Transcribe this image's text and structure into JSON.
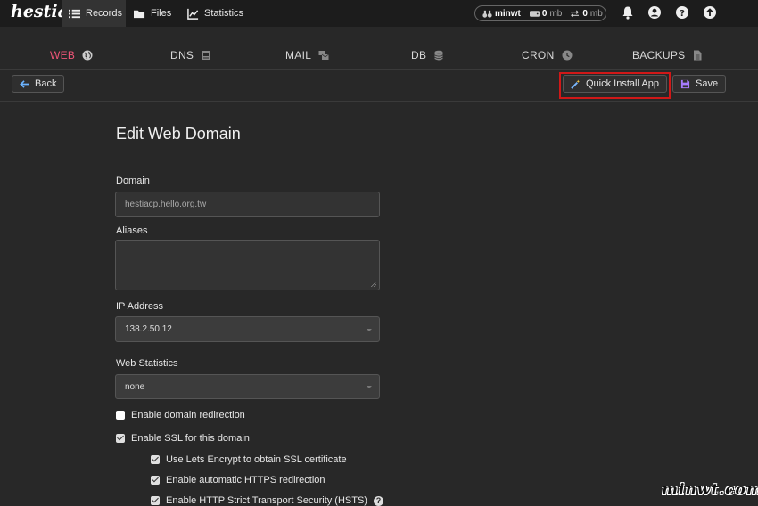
{
  "topbar": {
    "logo": "hestia",
    "nav": [
      {
        "label": "Records",
        "icon": "list-icon",
        "active": true
      },
      {
        "label": "Files",
        "icon": "folder-icon",
        "active": false
      },
      {
        "label": "Statistics",
        "icon": "chart-icon",
        "active": false
      }
    ],
    "stats": {
      "user": "minwt",
      "disk_value": "0",
      "disk_unit": "mb",
      "bandwidth_value": "0",
      "bandwidth_unit": "mb"
    }
  },
  "tabs": [
    {
      "label": "WEB",
      "icon": "globe-icon",
      "active": true
    },
    {
      "label": "DNS",
      "icon": "server-icon",
      "active": false
    },
    {
      "label": "MAIL",
      "icon": "mail-icon",
      "active": false
    },
    {
      "label": "DB",
      "icon": "database-icon",
      "active": false
    },
    {
      "label": "CRON",
      "icon": "clock-icon",
      "active": false
    },
    {
      "label": "BACKUPS",
      "icon": "file-icon",
      "active": false
    }
  ],
  "toolbar": {
    "back_label": "Back",
    "quick_install_label": "Quick Install App",
    "save_label": "Save"
  },
  "form": {
    "title": "Edit Web Domain",
    "domain_label": "Domain",
    "domain_value": "hestiacp.hello.org.tw",
    "aliases_label": "Aliases",
    "aliases_value": "",
    "ip_label": "IP Address",
    "ip_value": "138.2.50.12",
    "webstats_label": "Web Statistics",
    "webstats_value": "none",
    "redirect_label": "Enable domain redirection",
    "ssl_label": "Enable SSL for this domain",
    "letsencrypt_label": "Use Lets Encrypt to obtain SSL certificate",
    "https_redirect_label": "Enable automatic HTTPS redirection",
    "hsts_label": "Enable HTTP Strict Transport Security (HSTS)"
  },
  "watermark": "minwt.com",
  "colors": {
    "accent": "#ee5577",
    "highlight_border": "#d01818",
    "background": "#282828",
    "topbar": "#1c1c1c"
  }
}
